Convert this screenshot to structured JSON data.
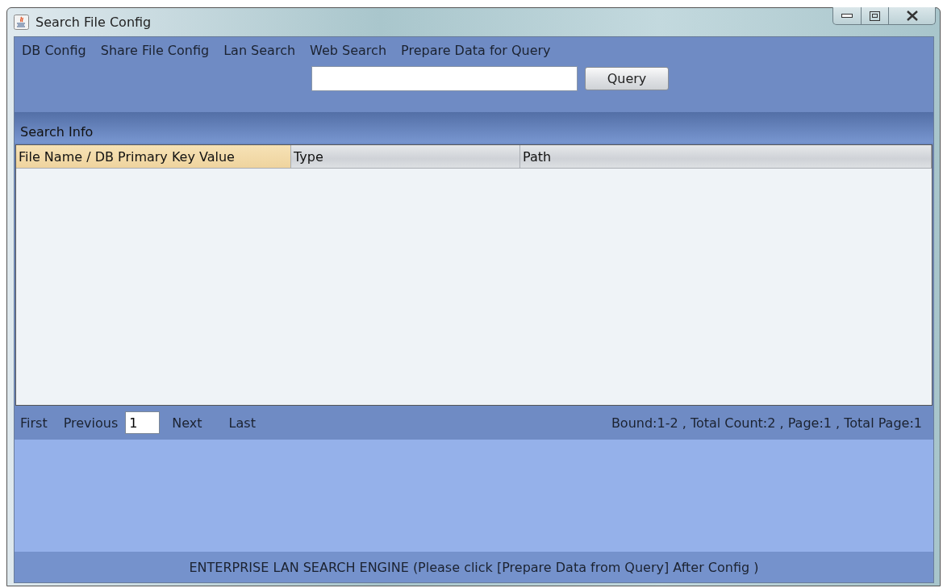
{
  "window": {
    "title": "Search File Config"
  },
  "menu": [
    {
      "label": "DB Config"
    },
    {
      "label": "Share File Config"
    },
    {
      "label": "Lan Search"
    },
    {
      "label": "Web Search"
    },
    {
      "label": "Prepare Data for Query"
    }
  ],
  "query": {
    "button": "Query"
  },
  "section": {
    "title": "Search Info"
  },
  "table": {
    "columns": [
      {
        "label": "File Name / DB Primary Key Value",
        "selected": true
      },
      {
        "label": "Type",
        "selected": false
      },
      {
        "label": "Path",
        "selected": false
      }
    ]
  },
  "pager": {
    "first": "First",
    "previous": "Previous",
    "page": "1",
    "next": "Next",
    "last": "Last",
    "summary": "Bound:1-2 , Total Count:2 , Page:1 , Total Page:1"
  },
  "status_bar": "ENTERPRISE LAN SEARCH ENGINE (Please click [Prepare Data from Query] After Config )"
}
